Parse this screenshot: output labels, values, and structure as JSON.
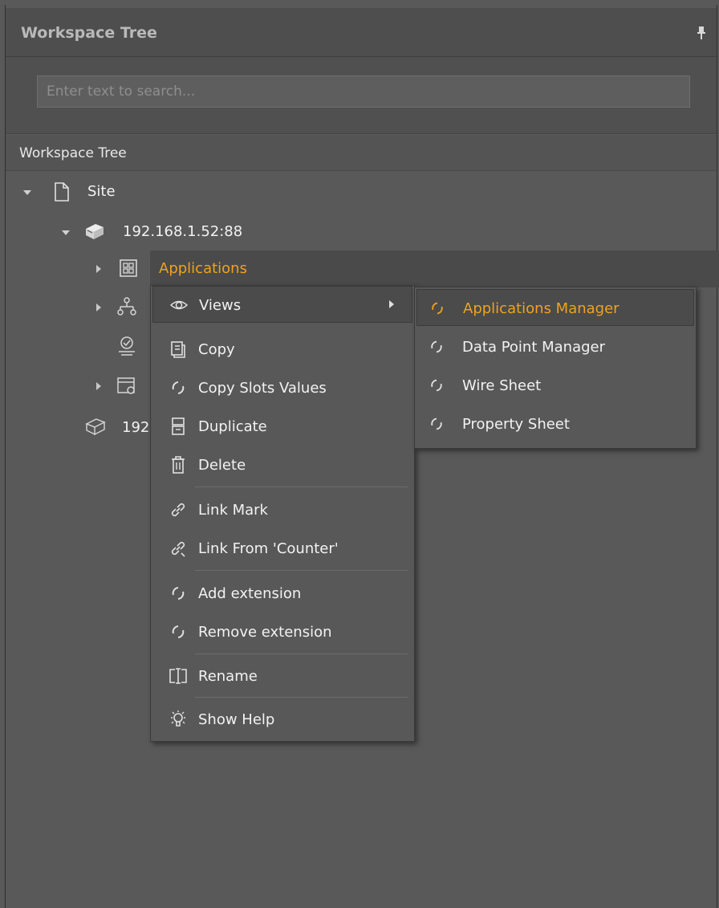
{
  "panel": {
    "title": "Workspace Tree",
    "pin_icon": "pin-icon",
    "search_placeholder": "Enter text to search...",
    "tree_header": "Workspace Tree"
  },
  "tree": {
    "site_label": "Site",
    "device_label": "192.168.1.52:88",
    "applications_label": "Applications",
    "truncated_device_label": "192"
  },
  "context_menu": {
    "items": [
      {
        "label": "Views",
        "icon": "eye-icon",
        "has_submenu": true
      },
      {
        "label": "Copy",
        "icon": "copy-icon"
      },
      {
        "label": "Copy Slots Values",
        "icon": "action-icon"
      },
      {
        "label": "Duplicate",
        "icon": "duplicate-icon"
      },
      {
        "label": "Delete",
        "icon": "trash-icon"
      },
      {
        "label": "Link Mark",
        "icon": "link-icon"
      },
      {
        "label": "Link From 'Counter'",
        "icon": "link-from-icon"
      },
      {
        "label": "Add extension",
        "icon": "action-icon"
      },
      {
        "label": "Remove extension",
        "icon": "action-icon"
      },
      {
        "label": "Rename",
        "icon": "rename-icon"
      },
      {
        "label": "Show Help",
        "icon": "lightbulb-icon"
      }
    ]
  },
  "views_submenu": {
    "items": [
      {
        "label": "Applications Manager",
        "icon": "action-icon",
        "selected": true
      },
      {
        "label": "Data Point Manager",
        "icon": "action-icon"
      },
      {
        "label": "Wire Sheet",
        "icon": "action-icon"
      },
      {
        "label": "Property Sheet",
        "icon": "action-icon"
      }
    ]
  },
  "colors": {
    "accent": "#f0a21c",
    "background": "#595959",
    "menu_background": "#585858"
  }
}
